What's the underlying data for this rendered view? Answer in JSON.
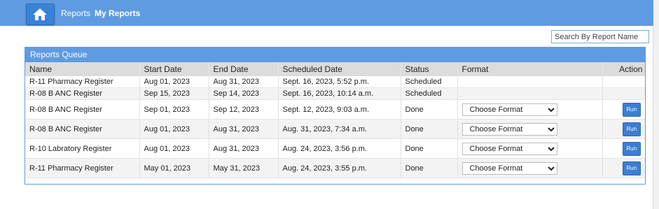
{
  "nav": {
    "reports_label": "Reports",
    "myreports_label": "My Reports"
  },
  "search": {
    "placeholder": "Search By Report Name"
  },
  "panel": {
    "title": "Reports Queue"
  },
  "columns": [
    "Name",
    "Start Date",
    "End Date",
    "Scheduled Date",
    "Status",
    "Format",
    "Action"
  ],
  "rows": [
    {
      "name": "R-11 Pharmacy Register",
      "start": "Aug 01, 2023",
      "end": "Aug 31, 2023",
      "scheduled": "Sept. 16, 2023, 5:52 p.m.",
      "status": "Scheduled"
    },
    {
      "name": "R-08 B ANC Register",
      "start": "Sep 15, 2023",
      "end": "Sep 14, 2023",
      "scheduled": "Sept. 16, 2023, 10:14 a.m.",
      "status": "Scheduled"
    },
    {
      "name": "R-08 B ANC Register",
      "start": "Sep 01, 2023",
      "end": "Sep 12, 2023",
      "scheduled": "Sept. 12, 2023, 9:03 a.m.",
      "status": "Done",
      "format": "Choose Format",
      "action": "Run"
    },
    {
      "name": "R-08 B ANC Register",
      "start": "Aug 01, 2023",
      "end": "Aug 31, 2023",
      "scheduled": "Aug. 31, 2023, 7:34 a.m.",
      "status": "Done",
      "format": "Choose Format",
      "action": "Run"
    },
    {
      "name": "R-10 Labratory Register",
      "start": "Aug 01, 2023",
      "end": "Aug 31, 2023",
      "scheduled": "Aug. 24, 2023, 3:56 p.m.",
      "status": "Done",
      "format": "Choose Format",
      "action": "Run"
    },
    {
      "name": "R-11 Pharmacy Register",
      "start": "May 01, 2023",
      "end": "May 31, 2023",
      "scheduled": "Aug. 24, 2023, 3:55 p.m.",
      "status": "Done",
      "format": "Choose Format",
      "action": "Run"
    }
  ],
  "colors": {
    "topbar": "#5f9be0",
    "home_button": "#3a82d6",
    "run_button": "#3a7fd0",
    "header_row": "#dcdcdc"
  },
  "icons": {
    "home": "home-icon",
    "dropdown": "chevron-down-icon"
  }
}
